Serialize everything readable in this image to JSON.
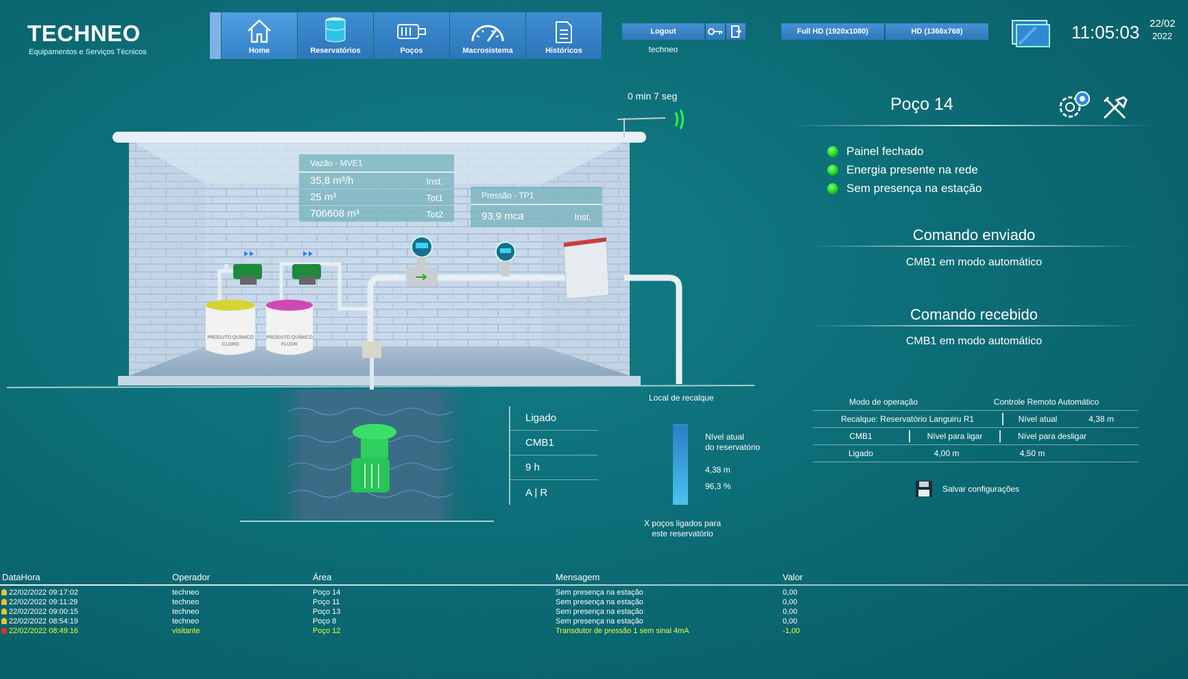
{
  "header": {
    "logo_title": "TECHNEO",
    "logo_subtitle": "Equipamentos e Serviços Técnicos",
    "nav": [
      {
        "label": "Home",
        "icon": "home-icon"
      },
      {
        "label": "Reservatórios",
        "icon": "reservoir-icon"
      },
      {
        "label": "Poços",
        "icon": "pump-icon"
      },
      {
        "label": "Macrosistema",
        "icon": "gauge-icon"
      },
      {
        "label": "Históricos",
        "icon": "document-icon"
      }
    ],
    "logout_label": "Logout",
    "username": "techneo",
    "res_full": "Full HD (1920x1080)",
    "res_hd": "HD (1366x768)",
    "time": "11:05:03",
    "date_day": "22/02",
    "date_year": "2022"
  },
  "scene": {
    "timer": "0 min 7 seg",
    "vazao": {
      "title": "Vazão - MVE1",
      "rows": [
        {
          "value": "35,8 m³/h",
          "unit": "Inst."
        },
        {
          "value": "25 m³",
          "unit": "Tot1"
        },
        {
          "value": "706608 m³",
          "unit": "Tot2"
        }
      ]
    },
    "pressao": {
      "title": "Pressão - TP1",
      "rows": [
        {
          "value": "93,9 mca",
          "unit": "Inst."
        }
      ]
    },
    "drum1_label": "PRODUTO QUÍMICO CLORO",
    "drum2_label": "PRODUTO QUÍMICO FLÚOR",
    "local_recalque": "Local de recalque",
    "pump_info": [
      "Ligado",
      "CMB1",
      "9 h",
      "A | R"
    ],
    "nivel_label_1": "Nível atual",
    "nivel_label_2": "do reservatório",
    "nivel_m": "4,38 m",
    "nivel_pct": "96,3 %",
    "nivel_fraction": 0.963,
    "pocos_1": "X poços ligados para",
    "pocos_2": "este reservatório"
  },
  "right": {
    "title": "Poço 14",
    "status": [
      "Painel fechado",
      "Energia presente na rede",
      "Sem presença na estação"
    ],
    "status_color": "#12c912",
    "cmd_sent_title": "Comando enviado",
    "cmd_sent_value": "CMB1 em modo automático",
    "cmd_recv_title": "Comando recebido",
    "cmd_recv_value": "CMB1 em modo automático",
    "table": {
      "modo_label": "Modo de operação",
      "modo_value": "Controle Remoto Automático",
      "recalque": "Recalque: Reservatório Languiru R1",
      "nivel_atual_label": "Nível atual",
      "nivel_atual_value": "4,38 m",
      "cmb": "CMB1",
      "ligar_label": "Nível para ligar",
      "desligar_label": "Nível para desligar",
      "estado": "Ligado",
      "ligar_value": "4,00 m",
      "desligar_value": "4,50 m"
    },
    "save_label": "Salvar configurações"
  },
  "alarms": {
    "headers": [
      "DataHora",
      "Operador",
      "Área",
      "Mensagem",
      "Valor"
    ],
    "rows": [
      {
        "datahora": "22/02/2022 09:17:02",
        "operador": "techneo",
        "area": "Poço 14",
        "mensagem": "Sem presença na estação",
        "valor": "0,00"
      },
      {
        "datahora": "22/02/2022 09:11:29",
        "operador": "techneo",
        "area": "Poço 11",
        "mensagem": "Sem presença na estação",
        "valor": "0,00"
      },
      {
        "datahora": "22/02/2022 09:00:15",
        "operador": "techneo",
        "area": "Poço 13",
        "mensagem": "Sem presença na estação",
        "valor": "0,00"
      },
      {
        "datahora": "22/02/2022 08:54:19",
        "operador": "techneo",
        "area": "Poço 8",
        "mensagem": "Sem presença na estação",
        "valor": "0,00"
      },
      {
        "datahora": "22/02/2022 08:49:16",
        "operador": "visitante",
        "area": "Poço 12",
        "mensagem": "Transdutor de pressão 1 sem sinal 4mA",
        "valor": "-1,00"
      }
    ],
    "warn_color": "#e8ff3c"
  }
}
